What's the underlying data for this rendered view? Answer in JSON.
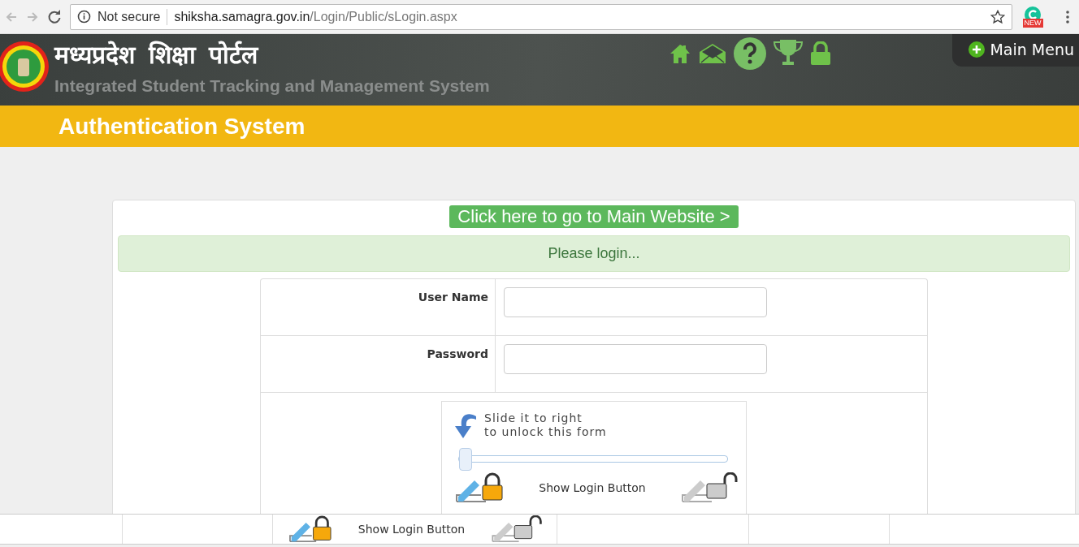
{
  "browser": {
    "security": "Not secure",
    "url_host": "shiksha.samagra.gov.in",
    "url_path": "/Login/Public/sLogin.aspx",
    "extension_badge": "NEW"
  },
  "header": {
    "title": "मध्यप्रदेश  शिक्षा  पोर्टल",
    "subtitle": "Integrated Student Tracking and Management System",
    "main_menu": "Main Menu"
  },
  "banner": {
    "title": "Authentication System"
  },
  "login": {
    "website_link": "Click here to go to Main Website >",
    "message": "Please login...",
    "fields": [
      {
        "label": "User Name"
      },
      {
        "label": "Password"
      }
    ],
    "slider": {
      "hint_lines": [
        "Slide it to right",
        "to unlock this form"
      ],
      "level": 0,
      "caption": "Show Login Button"
    }
  },
  "bottom_strip": {
    "caption": "Show Login Button"
  }
}
